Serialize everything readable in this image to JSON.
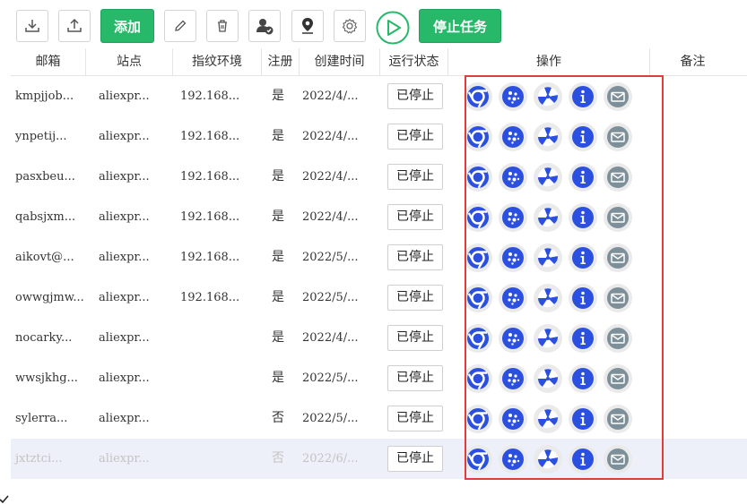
{
  "toolbar": {
    "add_label": "添加",
    "stop_task_label": "停止任务"
  },
  "table": {
    "headers": [
      "邮箱",
      "站点",
      "指纹环境",
      "注册",
      "创建时间",
      "运行状态",
      "操作",
      "备注"
    ],
    "rows": [
      {
        "email": "kmpjjob...",
        "site": "aliexpr...",
        "ip": "192.168...",
        "reg": "是",
        "date": "2022/4/...",
        "status": "已停止"
      },
      {
        "email": "ynpetij...",
        "site": "aliexpr...",
        "ip": "192.168...",
        "reg": "是",
        "date": "2022/4/...",
        "status": "已停止"
      },
      {
        "email": "pasxbeu...",
        "site": "aliexpr...",
        "ip": "192.168...",
        "reg": "是",
        "date": "2022/4/...",
        "status": "已停止"
      },
      {
        "email": "qabsjxm...",
        "site": "aliexpr...",
        "ip": "192.168...",
        "reg": "是",
        "date": "2022/4/...",
        "status": "已停止"
      },
      {
        "email": "aikovt@...",
        "site": "aliexpr...",
        "ip": "192.168...",
        "reg": "是",
        "date": "2022/5/...",
        "status": "已停止"
      },
      {
        "email": "owwgjmw...",
        "site": "aliexpr...",
        "ip": "192.168...",
        "reg": "是",
        "date": "2022/5/...",
        "status": "已停止"
      },
      {
        "email": "nocarky...",
        "site": "aliexpr...",
        "ip": "",
        "reg": "是",
        "date": "2022/4/...",
        "status": "已停止"
      },
      {
        "email": "wwsjkhg...",
        "site": "aliexpr...",
        "ip": "",
        "reg": "是",
        "date": "2022/5/...",
        "status": "已停止"
      },
      {
        "email": "sylerra...",
        "site": "aliexpr...",
        "ip": "",
        "reg": "否",
        "date": "2022/5/...",
        "status": "已停止"
      },
      {
        "email": "jxtztci...",
        "site": "aliexpr...",
        "ip": "",
        "reg": "否",
        "date": "2022/6/...",
        "status": "已停止"
      }
    ],
    "ops_icons": [
      "chrome-icon",
      "cookie-icon",
      "fan-icon",
      "info-icon",
      "mail-icon"
    ]
  },
  "colors": {
    "primary_green": "#27b869",
    "icon_blue": "#2b50e0",
    "mail_gray": "#7d8f98",
    "highlight_bar": "#e03c3c",
    "row_highlight": "#eef0f9"
  }
}
